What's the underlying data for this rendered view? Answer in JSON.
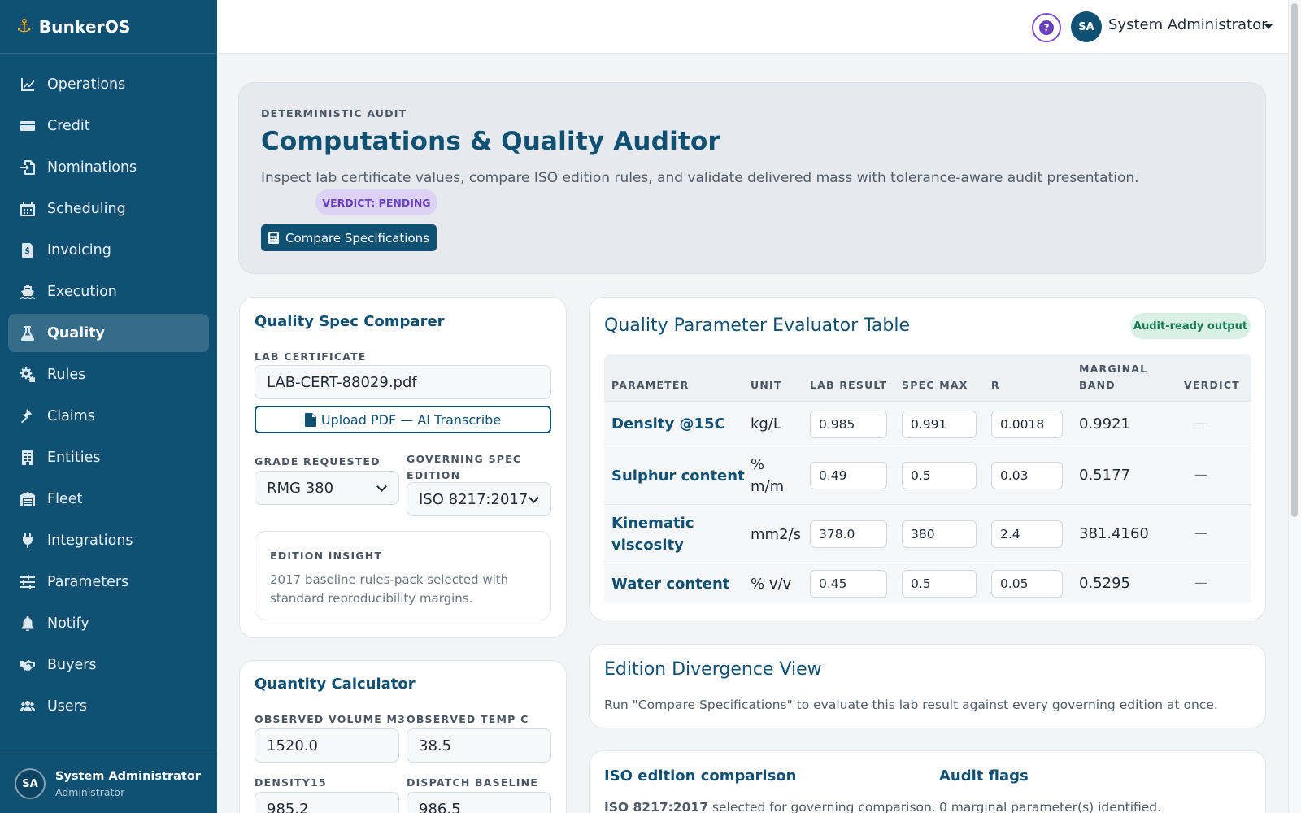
{
  "brand": {
    "name": "BunkerOS",
    "icon": "anchor-icon"
  },
  "nav": [
    {
      "label": "Operations",
      "icon": "chart-line-icon",
      "active": false
    },
    {
      "label": "Credit",
      "icon": "credit-card-icon",
      "active": false
    },
    {
      "label": "Nominations",
      "icon": "file-import-icon",
      "active": false
    },
    {
      "label": "Scheduling",
      "icon": "calendar-icon",
      "active": false
    },
    {
      "label": "Invoicing",
      "icon": "invoice-icon",
      "active": false
    },
    {
      "label": "Execution",
      "icon": "ship-icon",
      "active": false
    },
    {
      "label": "Quality",
      "icon": "flask-icon",
      "active": true
    },
    {
      "label": "Rules",
      "icon": "cogs-icon",
      "active": false
    },
    {
      "label": "Claims",
      "icon": "gavel-icon",
      "active": false
    },
    {
      "label": "Entities",
      "icon": "building-icon",
      "active": false
    },
    {
      "label": "Fleet",
      "icon": "warehouse-icon",
      "active": false
    },
    {
      "label": "Integrations",
      "icon": "plug-icon",
      "active": false
    },
    {
      "label": "Parameters",
      "icon": "sliders-icon",
      "active": false
    },
    {
      "label": "Notify",
      "icon": "bell-icon",
      "active": false
    },
    {
      "label": "Buyers",
      "icon": "handshake-icon",
      "active": false
    },
    {
      "label": "Users",
      "icon": "users-icon",
      "active": false
    }
  ],
  "sidebar_user": {
    "initials": "SA",
    "name": "System Administrator",
    "role": "Administrator"
  },
  "topbar": {
    "help_glyph": "?",
    "initials": "SA",
    "user_name": "System Administrator"
  },
  "hero": {
    "eyebrow": "DETERMINISTIC AUDIT",
    "title": "Computations & Quality Auditor",
    "description": "Inspect lab certificate values, compare ISO edition rules, and validate delivered mass with tolerance-aware audit presentation.",
    "verdict": "VERDICT: PENDING",
    "compare_button": "Compare Specifications"
  },
  "spec_comparer": {
    "title": "Quality Spec Comparer",
    "lab_cert_label": "LAB CERTIFICATE",
    "lab_cert_value": "LAB-CERT-88029.pdf",
    "upload_button": "Upload PDF — AI Transcribe",
    "grade_label": "GRADE REQUESTED",
    "grade_value": "RMG 380",
    "edition_label_1": "GOVERNING SPEC",
    "edition_label_2": "EDITION",
    "edition_value": "ISO 8217:2017",
    "insight_label": "EDITION INSIGHT",
    "insight_text": "2017 baseline rules-pack selected with standard reproducibility margins."
  },
  "quantity_calc": {
    "title": "Quantity Calculator",
    "volume_label": "OBSERVED VOLUME M3",
    "volume_value": "1520.0",
    "temp_label": "OBSERVED TEMP C",
    "temp_value": "38.5",
    "density_label": "DENSITY15",
    "density_value": "985.2",
    "baseline_label": "DISPATCH BASELINE",
    "baseline_value": "986.5"
  },
  "evaluator": {
    "title": "Quality Parameter Evaluator Table",
    "badge": "Audit-ready output",
    "headers": {
      "parameter": "PARAMETER",
      "unit": "UNIT",
      "lab": "LAB RESULT",
      "spec": "SPEC MAX",
      "r": "R",
      "band_1": "MARGINAL",
      "band_2": "BAND",
      "verdict": "VERDICT"
    },
    "rows": [
      {
        "param_1": "Density @15C",
        "param_2": "",
        "unit_1": "kg/L",
        "unit_2": "",
        "lab": "0.985",
        "spec": "0.991",
        "r": "0.0018",
        "band": "0.9921",
        "verdict": "—"
      },
      {
        "param_1": "Sulphur content",
        "param_2": "",
        "unit_1": "%",
        "unit_2": "m/m",
        "lab": "0.49",
        "spec": "0.5",
        "r": "0.03",
        "band": "0.5177",
        "verdict": "—"
      },
      {
        "param_1": "Kinematic",
        "param_2": "viscosity",
        "unit_1": "mm2/s",
        "unit_2": "",
        "lab": "378.0",
        "spec": "380",
        "r": "2.4",
        "band": "381.4160",
        "verdict": "—"
      },
      {
        "param_1": "Water content",
        "param_2": "",
        "unit_1": "% v/v",
        "unit_2": "",
        "lab": "0.45",
        "spec": "0.5",
        "r": "0.05",
        "band": "0.5295",
        "verdict": "—"
      }
    ]
  },
  "divergence": {
    "title": "Edition Divergence View",
    "text": "Run \"Compare Specifications\" to evaluate this lab result against every governing edition at once."
  },
  "iso_compare": {
    "title": "ISO edition comparison",
    "edition_bold": "ISO 8217:2017",
    "text_rest": " selected for governing comparison."
  },
  "audit_flags": {
    "title": "Audit flags",
    "text": "0 marginal parameter(s) identified."
  }
}
